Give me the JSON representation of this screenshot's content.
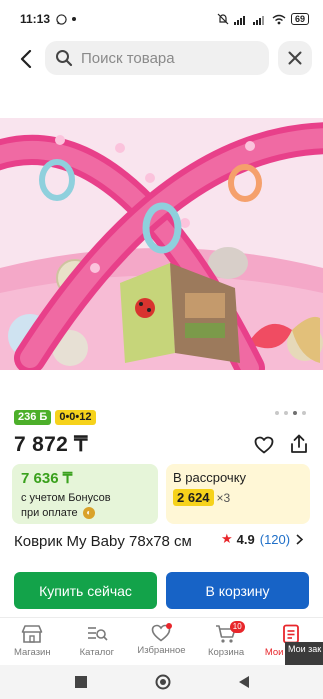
{
  "status_bar": {
    "time": "11:13",
    "battery": "69"
  },
  "search": {
    "placeholder": "Поиск товара"
  },
  "badges": {
    "bonus": "236 Б",
    "installment": "0•0•12"
  },
  "product": {
    "price": "7 872 ₸",
    "title": "Коврик My Baby 78x78 см",
    "rating": "4.9",
    "rating_count": "(120)"
  },
  "bonus_card": {
    "price": "7 636 ₸",
    "line1": "с учетом Бонусов",
    "line2": "при оплате"
  },
  "installment_card": {
    "label": "В рассрочку",
    "amount": "2 624",
    "multiplier": "×3"
  },
  "actions": {
    "buy_now": "Купить сейчас",
    "to_cart": "В корзину"
  },
  "bottom_nav": {
    "items": [
      {
        "label": "Магазин",
        "icon": "shop-icon"
      },
      {
        "label": "Каталог",
        "icon": "catalog-icon"
      },
      {
        "label": "Избранное",
        "icon": "heart-icon"
      },
      {
        "label": "Корзина",
        "icon": "cart-icon",
        "count": "10"
      },
      {
        "label": "Мои заказы",
        "icon": "orders-icon"
      }
    ]
  },
  "tooltip": {
    "text": "Мои зак https://..."
  },
  "carousel": {
    "total": 4,
    "active": 3
  },
  "colors": {
    "accent_red": "#e8262b",
    "buy_green": "#13a34a",
    "cart_blue": "#1763c6",
    "bonus_green": "#3aa11d",
    "installment_yellow": "#f6d21b"
  }
}
